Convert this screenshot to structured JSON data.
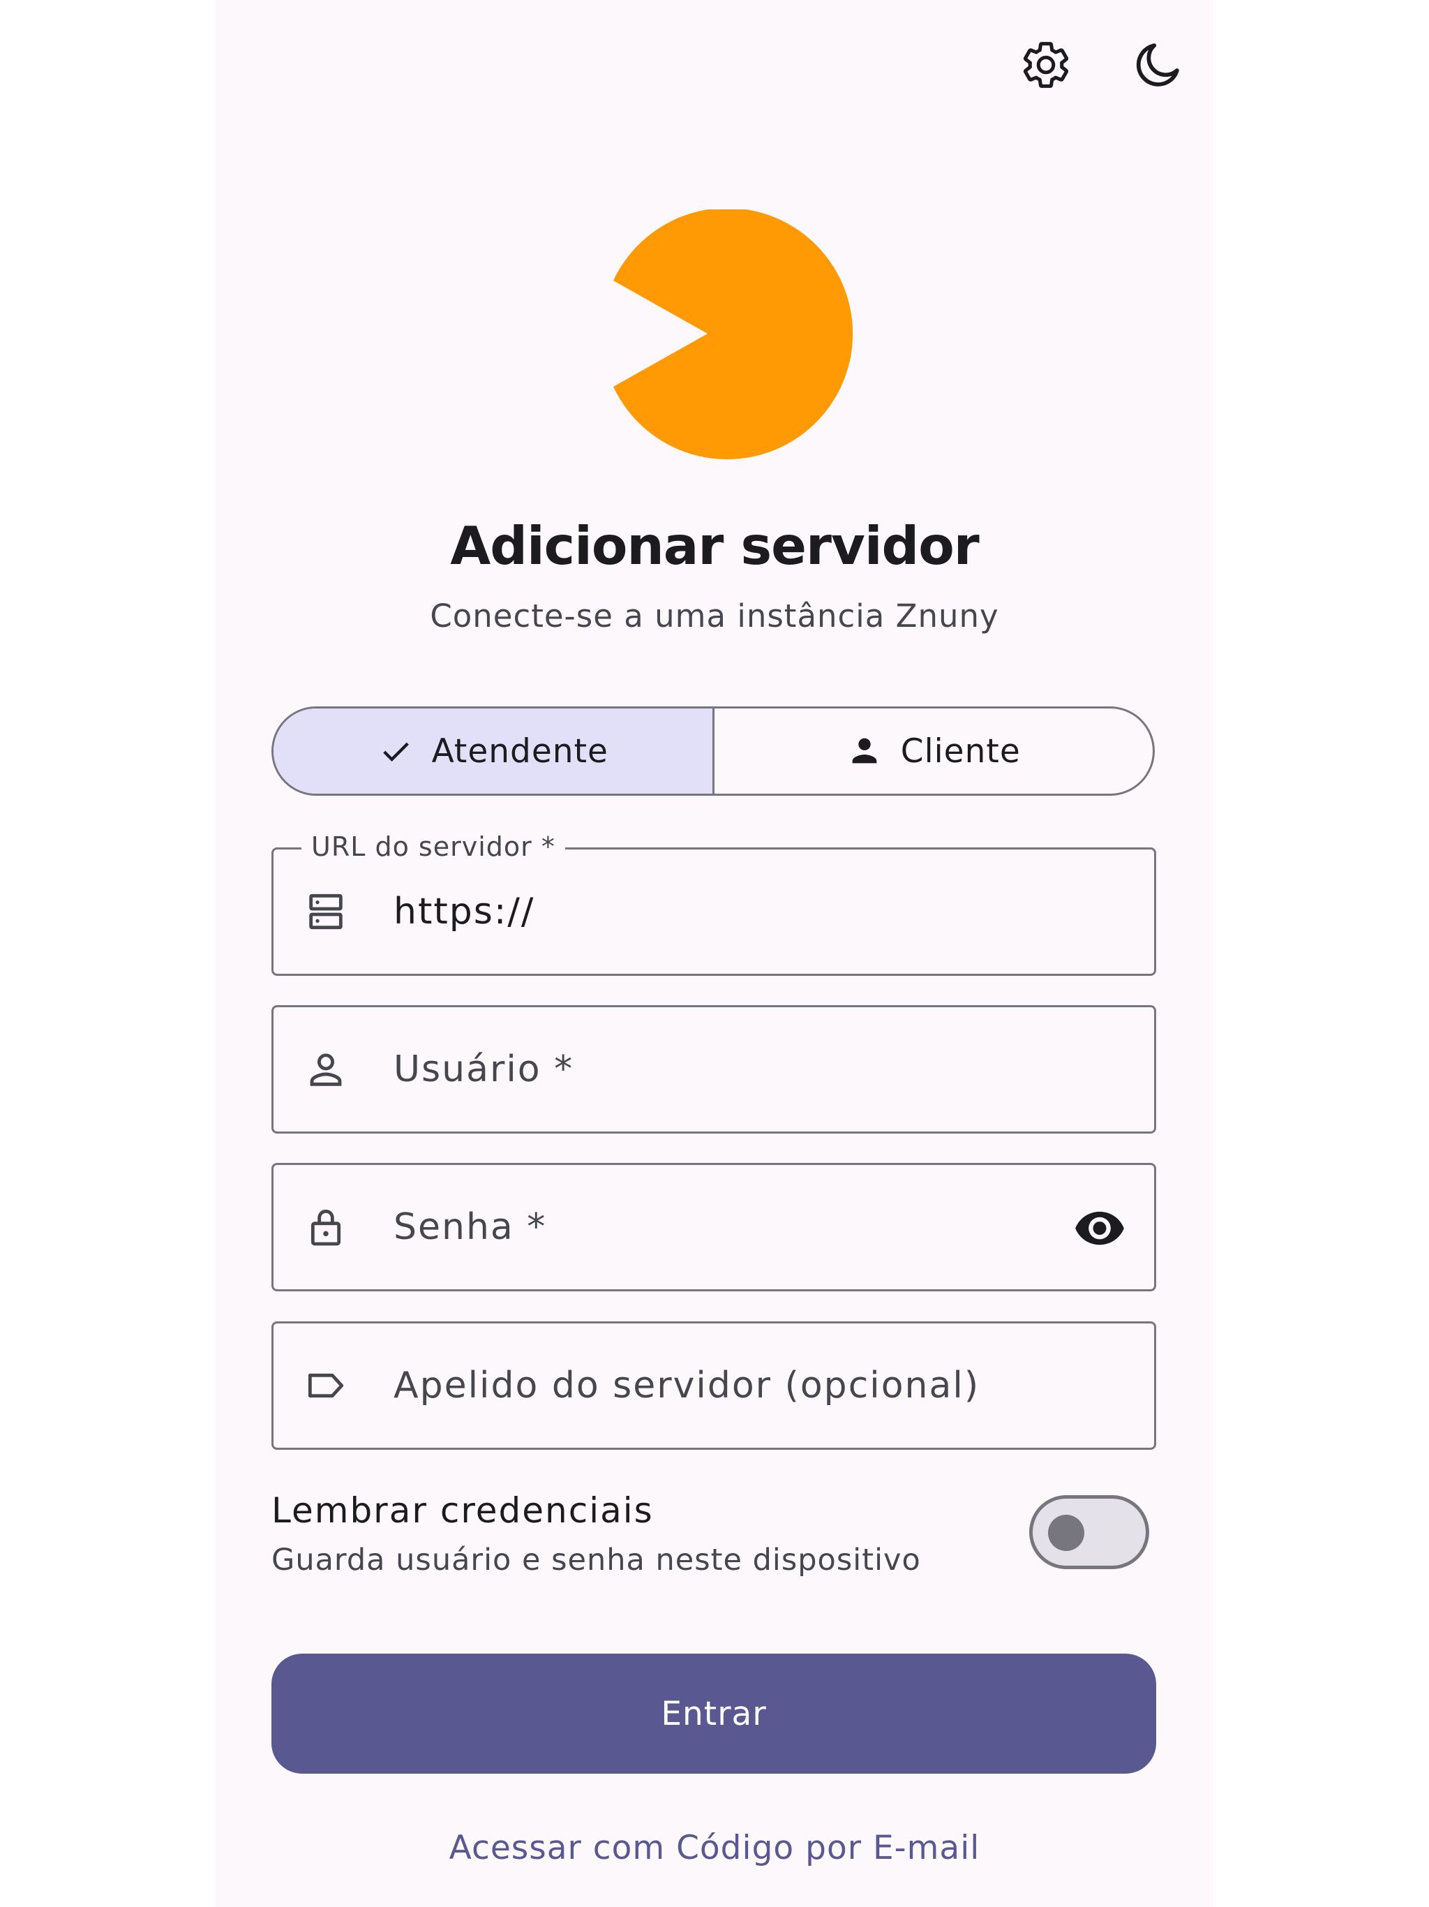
{
  "header": {
    "settings_icon": "gear-icon",
    "theme_icon": "moon-icon"
  },
  "logo": {
    "color": "#ff9a05"
  },
  "title": "Adicionar servidor",
  "subtitle": "Conecte-se a uma instância Znuny",
  "role_toggle": {
    "options": [
      {
        "label": "Atendente",
        "icon": "check-icon",
        "selected": true
      },
      {
        "label": "Cliente",
        "icon": "person-icon",
        "selected": false
      }
    ]
  },
  "fields": {
    "server_url": {
      "label": "URL do servidor *",
      "value": "https://",
      "icon": "server-icon"
    },
    "username": {
      "placeholder": "Usuário *",
      "icon": "person-outline-icon"
    },
    "password": {
      "placeholder": "Senha *",
      "icon": "lock-icon",
      "trailing_icon": "eye-icon"
    },
    "nickname": {
      "placeholder": "Apelido do servidor (opcional)",
      "icon": "label-icon"
    }
  },
  "remember": {
    "title": "Lembrar credenciais",
    "subtitle": "Guarda usuário e senha neste dispositivo",
    "enabled": false
  },
  "submit_label": "Entrar",
  "email_code_link": "Acessar com Código por E-mail",
  "colors": {
    "primary": "#5a5891",
    "selected_segment": "#e2e0f9",
    "background": "#fcf8fc",
    "outline": "#77767f"
  }
}
